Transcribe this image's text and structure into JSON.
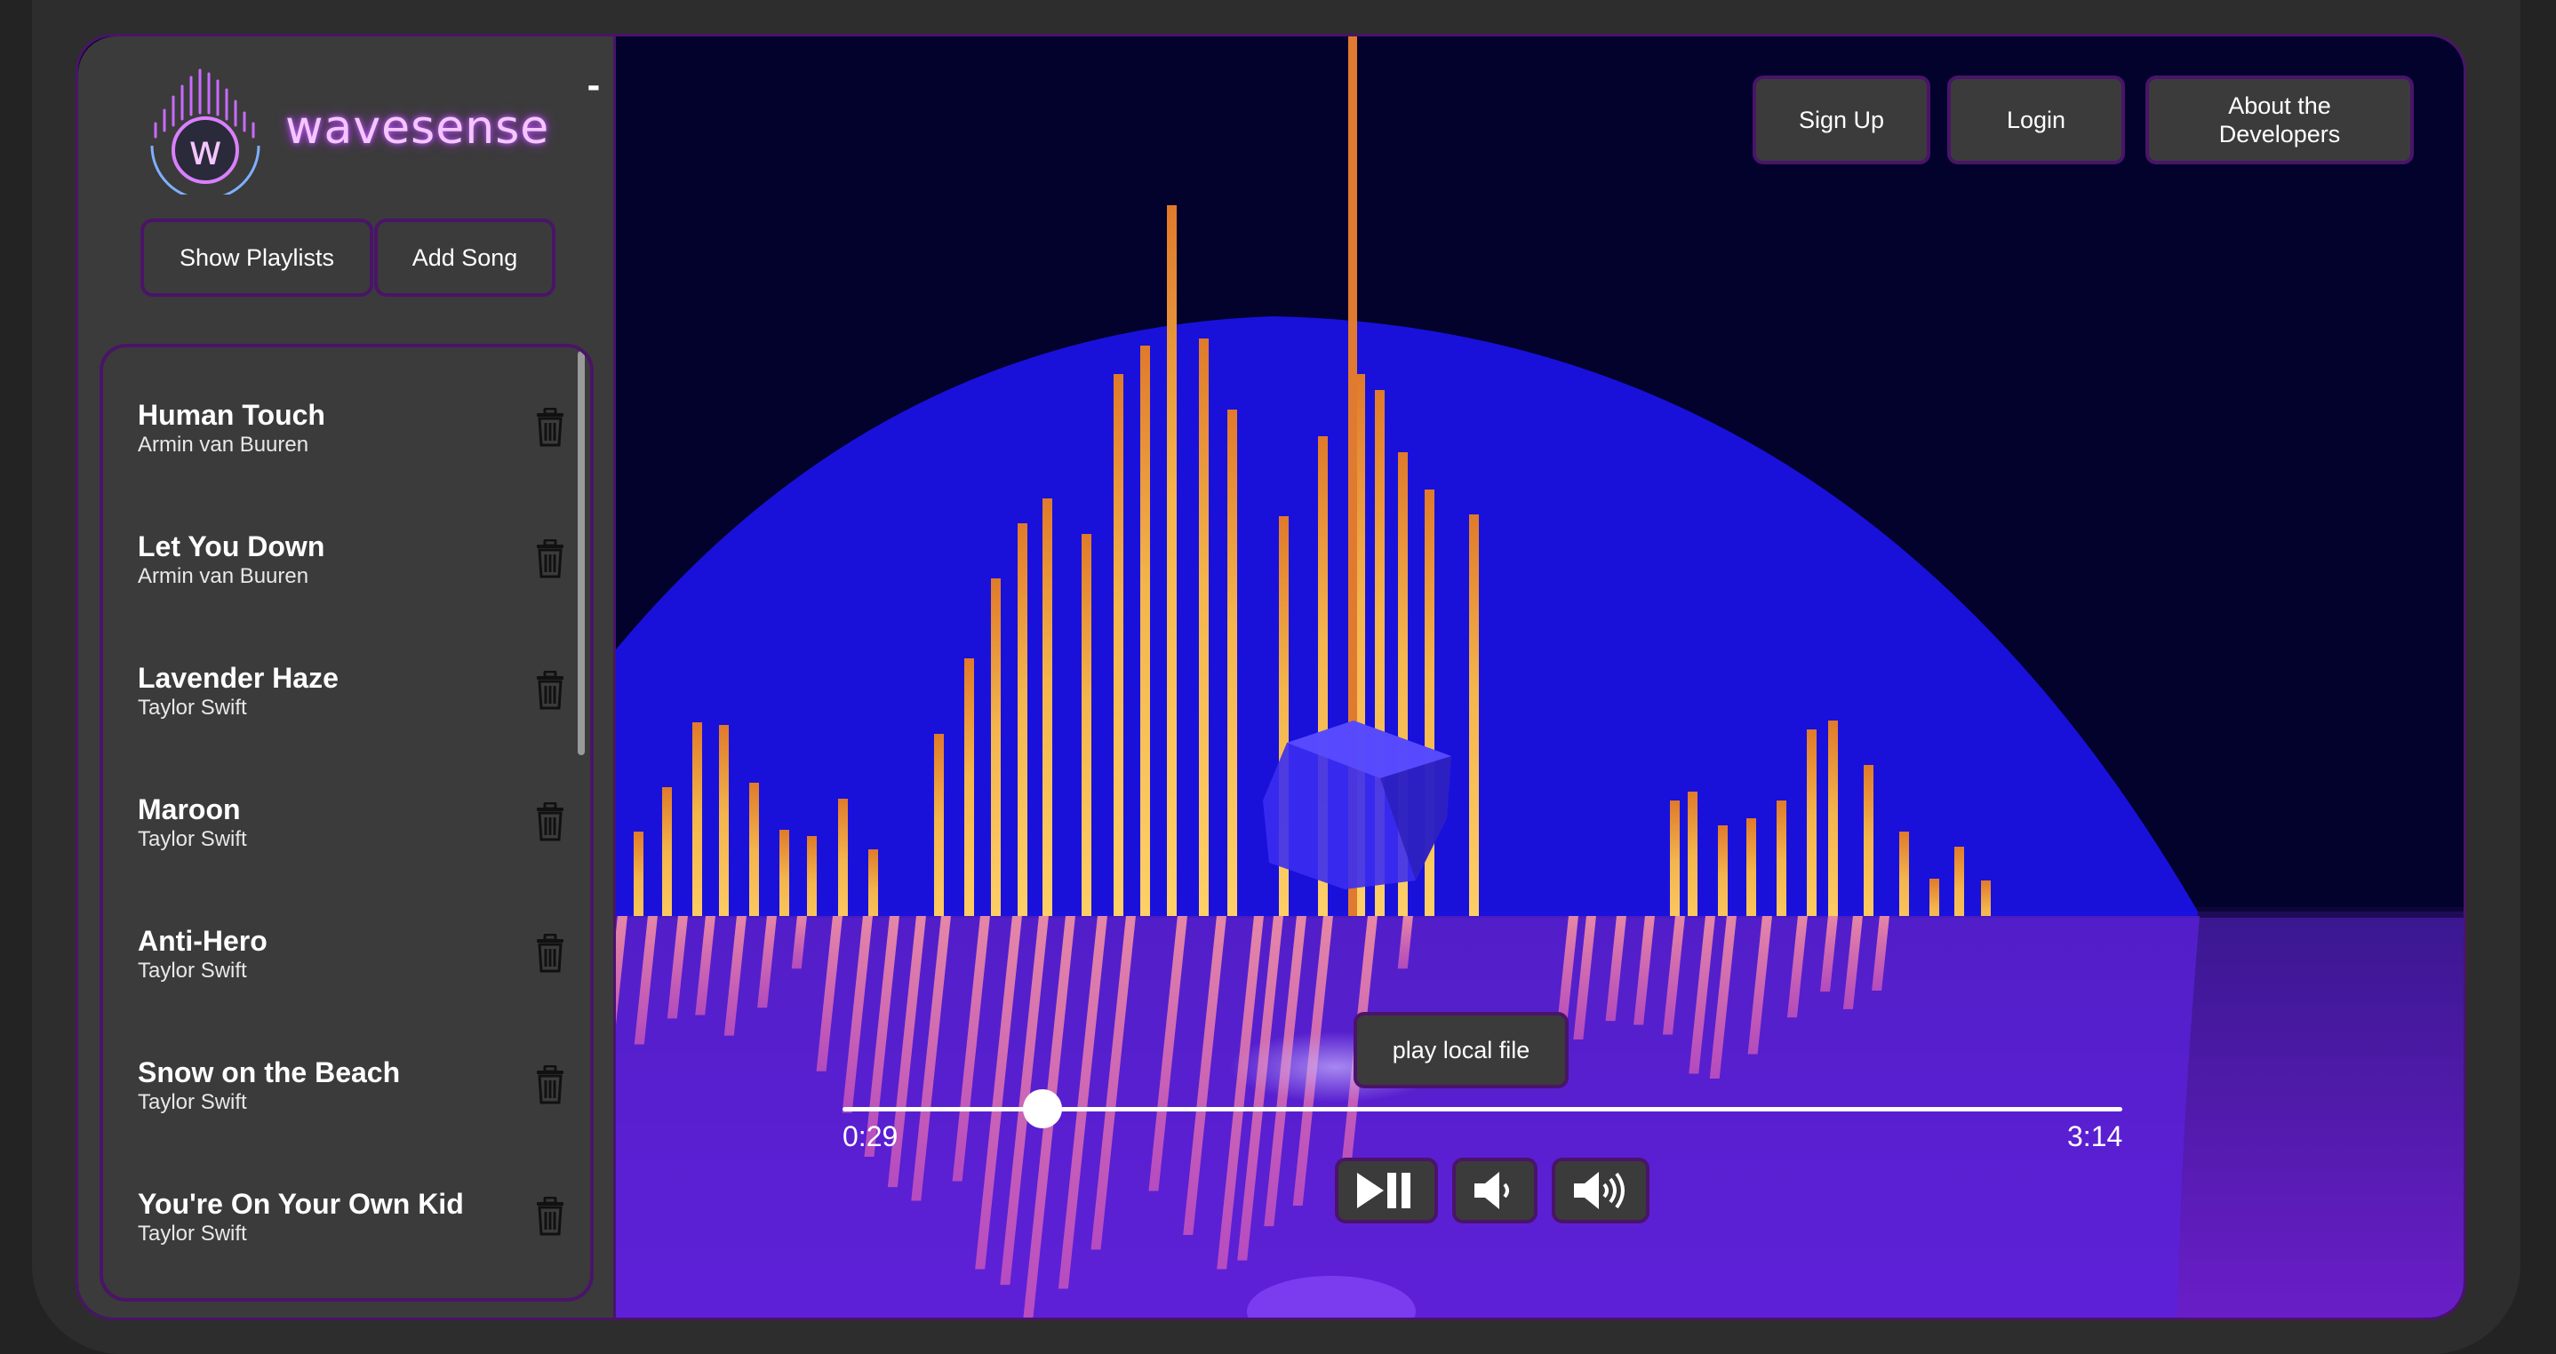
{
  "app": {
    "name": "wavesense"
  },
  "sidebar": {
    "collapse_label": "-",
    "buttons": {
      "show_playlists": "Show Playlists",
      "add_song": "Add Song"
    },
    "songs": [
      {
        "title": "Human Touch",
        "artist": "Armin van Buuren"
      },
      {
        "title": "Let You Down",
        "artist": "Armin van Buuren"
      },
      {
        "title": "Lavender Haze",
        "artist": "Taylor Swift"
      },
      {
        "title": "Maroon",
        "artist": "Taylor Swift"
      },
      {
        "title": "Anti-Hero",
        "artist": "Taylor Swift"
      },
      {
        "title": "Snow on the Beach",
        "artist": "Taylor Swift"
      },
      {
        "title": "You're On Your Own Kid",
        "artist": "Taylor Swift"
      }
    ]
  },
  "nav": {
    "sign_up": "Sign Up",
    "login": "Login",
    "about": "About the Developers"
  },
  "player": {
    "play_local_label": "play local file",
    "current_time": "0:29",
    "duration": "3:14",
    "progress": 0.156,
    "controls": [
      "play-pause-icon",
      "volume-down-icon",
      "volume-up-icon"
    ]
  },
  "colors": {
    "accent_border": "#4a1468",
    "panel": "#3b3b3b",
    "bar": "#f5b94a",
    "sphere": "#1a12e0",
    "floor": "#5a18b8"
  }
}
